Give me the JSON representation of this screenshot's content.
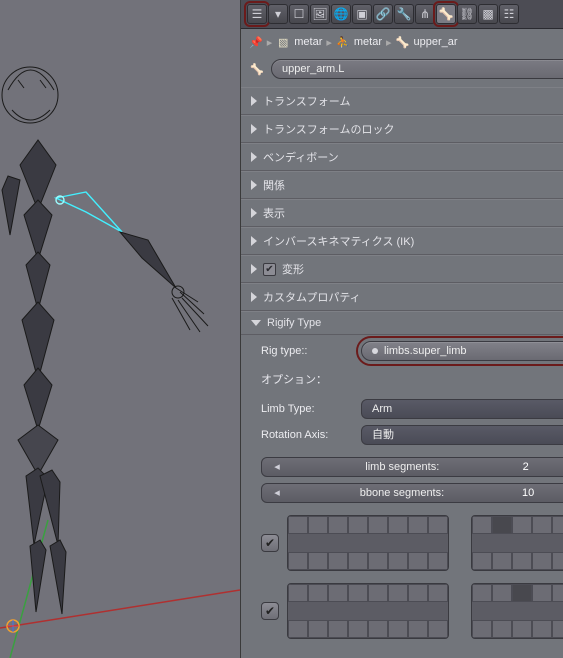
{
  "breadcrumb": {
    "obj": "metar",
    "arm": "metar",
    "bone": "upper_ar"
  },
  "bone_name": "upper_arm.L",
  "sections": {
    "transform": "トランスフォーム",
    "transform_lock": "トランスフォームのロック",
    "bendy": "ベンディボーン",
    "relations": "関係",
    "display": "表示",
    "ik": "インバースキネマティクス (IK)",
    "deform": "変形",
    "custom": "カスタムプロパティ",
    "rigify": "Rigify Type"
  },
  "rigify": {
    "rig_type_label": "Rig type::",
    "rig_type_value": "limbs.super_limb",
    "options_label": "オプション：",
    "limb_type_label": "Limb Type:",
    "limb_type_value": "Arm",
    "rotation_axis_label": "Rotation Axis:",
    "rotation_axis_value": "自動",
    "limb_segments_label": "limb segments:",
    "limb_segments_value": "2",
    "bbone_segments_label": "bbone segments:",
    "bbone_segments_value": "10"
  }
}
